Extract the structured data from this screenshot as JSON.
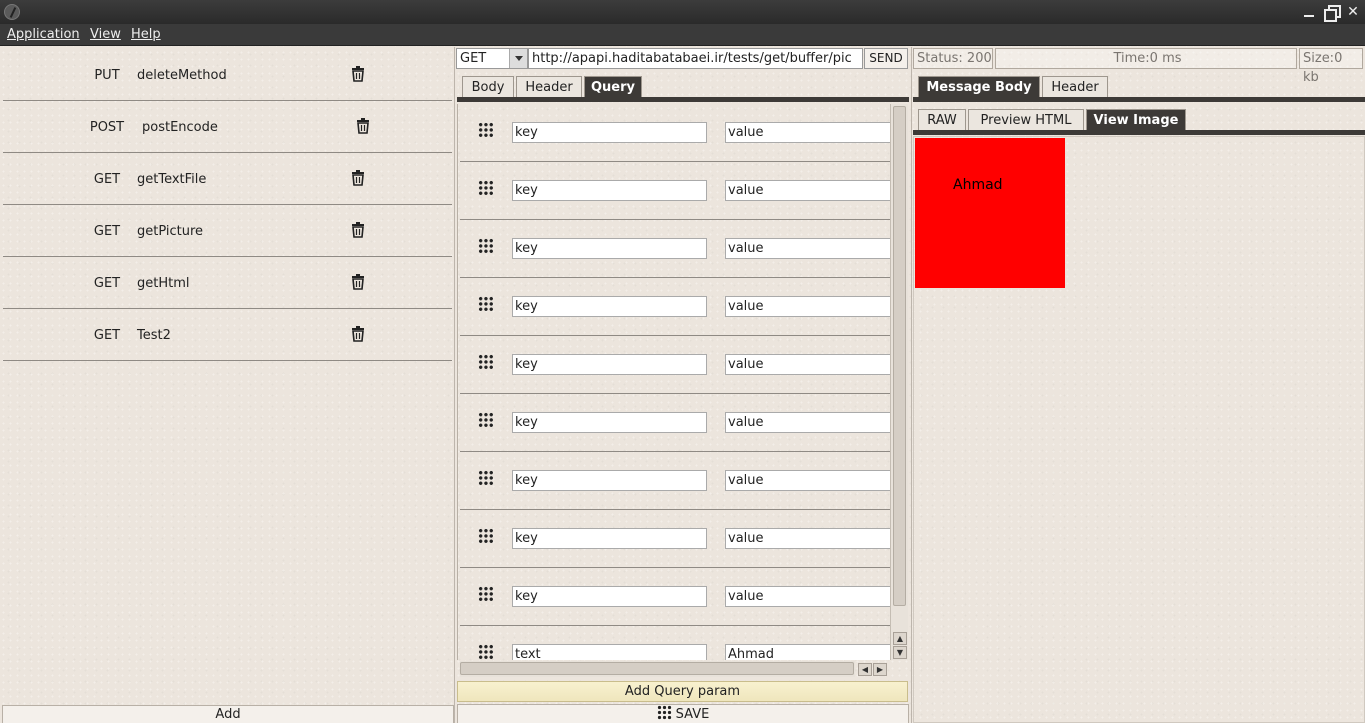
{
  "menu": {
    "application": "Application",
    "view": "View",
    "help": "Help"
  },
  "requests": [
    {
      "method": "PUT",
      "name": "deleteMethod"
    },
    {
      "method": "POST",
      "name": "postEncode"
    },
    {
      "method": "GET",
      "name": "getTextFile"
    },
    {
      "method": "GET",
      "name": "getPicture"
    },
    {
      "method": "GET",
      "name": "getHtml"
    },
    {
      "method": "GET",
      "name": "Test2"
    }
  ],
  "left": {
    "add_label": "Add"
  },
  "request_bar": {
    "method": "GET",
    "url": "http://apapi.haditabatabaei.ir/tests/get/buffer/pic",
    "send_label": "SEND"
  },
  "request_tabs": [
    "Body",
    "Header",
    "Query"
  ],
  "query_params": [
    {
      "key": "key",
      "value": "value"
    },
    {
      "key": "key",
      "value": "value"
    },
    {
      "key": "key",
      "value": "value"
    },
    {
      "key": "key",
      "value": "value"
    },
    {
      "key": "key",
      "value": "value"
    },
    {
      "key": "key",
      "value": "value"
    },
    {
      "key": "key",
      "value": "value"
    },
    {
      "key": "key",
      "value": "value"
    },
    {
      "key": "key",
      "value": "value"
    },
    {
      "key": "text",
      "value": "Ahmad"
    }
  ],
  "middle": {
    "add_query_label": "Add Query param",
    "save_label": "SAVE"
  },
  "status": {
    "status": "Status: 200",
    "time": "Time:0 ms",
    "size": "Size:0 kb"
  },
  "response_tabs": [
    "Message Body",
    "Header"
  ],
  "body_tabs": [
    "RAW",
    "Preview HTML",
    "View Image"
  ],
  "preview": {
    "text": "Ahmad",
    "color": "#ff0000"
  }
}
